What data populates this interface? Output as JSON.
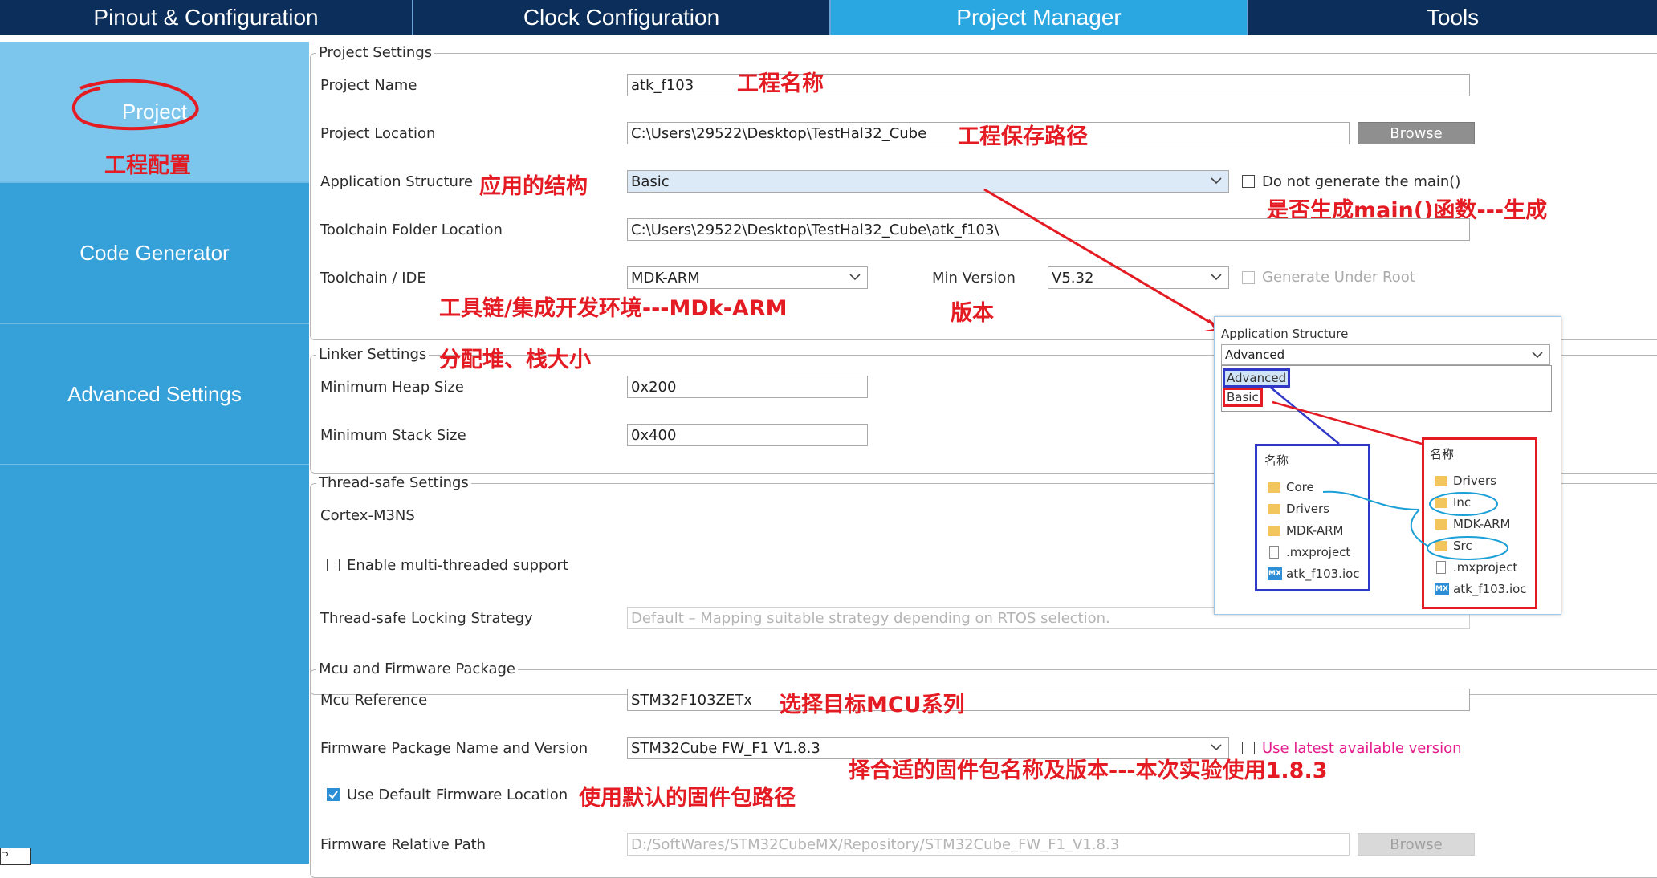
{
  "tabs": [
    {
      "label": "Pinout & Configuration"
    },
    {
      "label": "Clock Configuration"
    },
    {
      "label": "Project Manager"
    },
    {
      "label": "Tools"
    }
  ],
  "sidebar": {
    "items": [
      {
        "label": "Project"
      },
      {
        "label": "Code Generator"
      },
      {
        "label": "Advanced Settings"
      }
    ]
  },
  "project_settings": {
    "title": "Project Settings",
    "project_name_label": "Project Name",
    "project_name_value": "atk_f103",
    "project_location_label": "Project Location",
    "project_location_value": "C:\\Users\\29522\\Desktop\\TestHal32_Cube",
    "browse_label": "Browse",
    "app_structure_label": "Application Structure",
    "app_structure_value": "Basic",
    "no_main_label": "Do not generate the main()",
    "toolchain_folder_label": "Toolchain Folder Location",
    "toolchain_folder_value": "C:\\Users\\29522\\Desktop\\TestHal32_Cube\\atk_f103\\",
    "toolchain_ide_label": "Toolchain / IDE",
    "toolchain_ide_value": "MDK-ARM",
    "min_version_label": "Min Version",
    "min_version_value": "V5.32",
    "generate_under_root_label": "Generate Under Root"
  },
  "linker_settings": {
    "title": "Linker Settings",
    "heap_label": "Minimum Heap Size",
    "heap_value": "0x200",
    "stack_label": "Minimum Stack Size",
    "stack_value": "0x400"
  },
  "thread_safe": {
    "title": "Thread-safe Settings",
    "core_label": "Cortex-M3NS",
    "enable_label": "Enable multi-threaded support",
    "strategy_label": "Thread-safe Locking Strategy",
    "strategy_value": "Default  –  Mapping suitable strategy depending on RTOS selection."
  },
  "mcu_firmware": {
    "title": "Mcu and Firmware Package",
    "mcu_ref_label": "Mcu Reference",
    "mcu_ref_value": "STM32F103ZETx",
    "fw_name_label": "Firmware Package Name and Version",
    "fw_name_value": "STM32Cube FW_F1 V1.8.3",
    "latest_label": "Use latest available version",
    "default_loc_label": "Use Default Firmware Location",
    "rel_path_label": "Firmware Relative Path",
    "rel_path_value": "D:/SoftWares/STM32CubeMX/Repository/STM32Cube_FW_F1_V1.8.3",
    "browse_label": "Browse"
  },
  "annotations": {
    "project_config": "工程配置",
    "project_name": "工程名称",
    "project_path": "工程保存路径",
    "app_structure": "应用的结构",
    "main_func": "是否生成main()函数---生成",
    "toolchain": "工具链/集成开发环境---MDk-ARM",
    "version": "版本",
    "linker": "分配堆、栈大小",
    "mcu": "选择目标MCU系列",
    "firmware": "择合适的固件包名称及版本---本次实验使用1.8.3",
    "default_path": "使用默认的固件包路径"
  },
  "popup": {
    "title": "Application Structure",
    "selected": "Advanced",
    "options": [
      "Advanced",
      "Basic"
    ],
    "left_header": "名称",
    "left_items": [
      "Core",
      "Drivers",
      "MDK-ARM",
      ".mxproject",
      "atk_f103.ioc"
    ],
    "right_header": "名称",
    "right_items": [
      "Drivers",
      "Inc",
      "MDK-ARM",
      "Src",
      ".mxproject",
      "atk_f103.ioc"
    ],
    "mx_badge": "MX"
  },
  "bottom_left": "⊃"
}
